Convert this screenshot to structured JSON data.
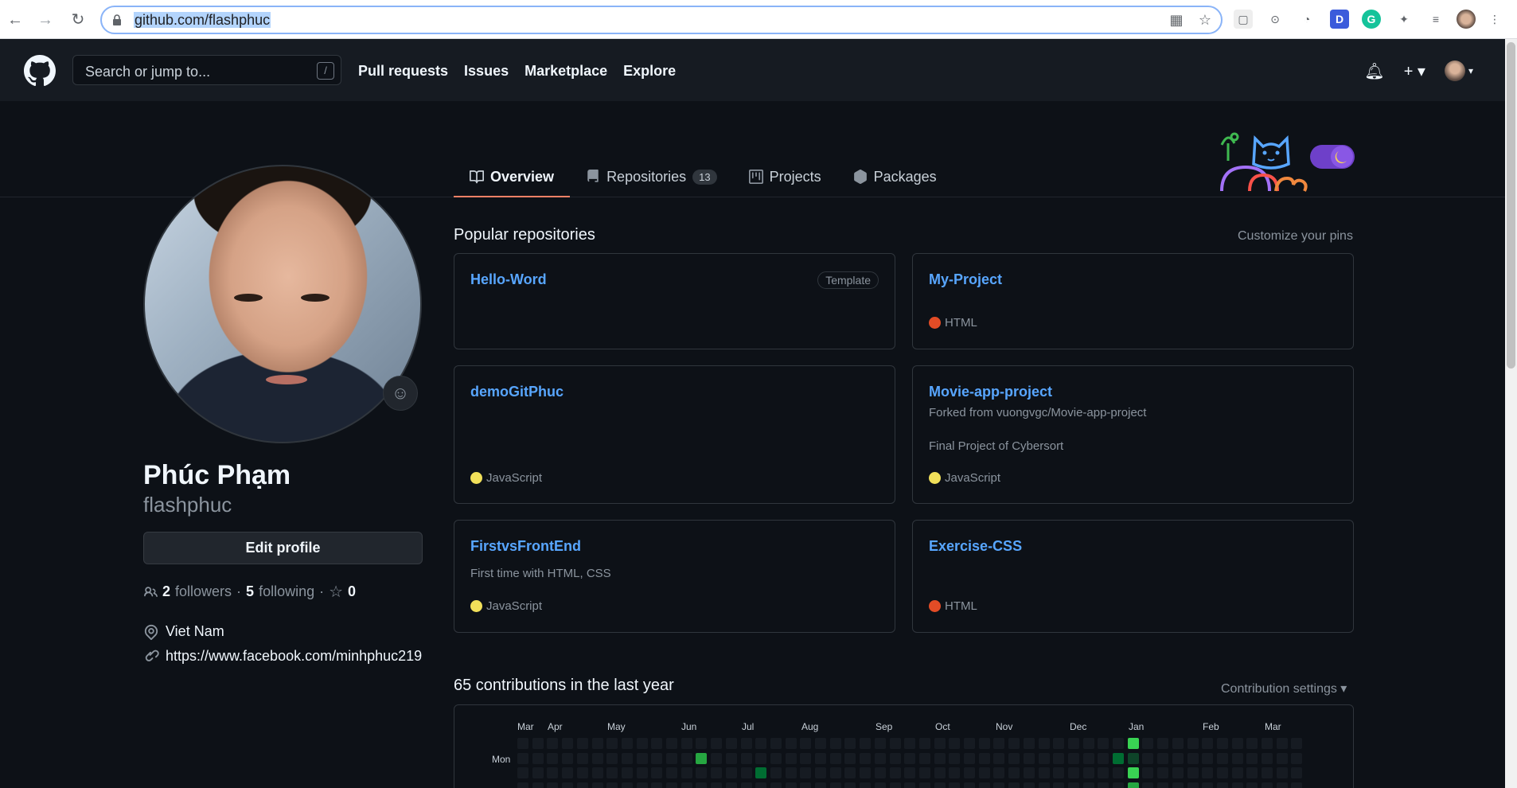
{
  "browser": {
    "url_prefix": "github.com/flashphuc",
    "back_icon": "arrow-left-icon",
    "forward_icon": "arrow-right-icon",
    "reload_icon": "reload-icon"
  },
  "header": {
    "search_placeholder": "Search or jump to...",
    "search_shortcut": "/",
    "nav": [
      "Pull requests",
      "Issues",
      "Marketplace",
      "Explore"
    ]
  },
  "tabs": [
    {
      "label": "Overview",
      "active": true
    },
    {
      "label": "Repositories",
      "count": "13"
    },
    {
      "label": "Projects"
    },
    {
      "label": "Packages"
    }
  ],
  "profile": {
    "fullname": "Phúc Phạm",
    "username": "flashphuc",
    "edit_label": "Edit profile",
    "followers_count": "2",
    "followers_label": "followers",
    "following_count": "5",
    "following_label": "following",
    "stars_count": "0",
    "location": "Viet Nam",
    "website": "https://www.facebook.com/minhphuc219"
  },
  "popular": {
    "title": "Popular repositories",
    "customize": "Customize your pins",
    "repos": [
      {
        "name": "Hello-Word",
        "badge": "Template"
      },
      {
        "name": "My-Project",
        "language": "HTML",
        "lang_color": "#e34c26"
      },
      {
        "name": "demoGitPhuc",
        "language": "JavaScript",
        "lang_color": "#f1e05a"
      },
      {
        "name": "Movie-app-project",
        "forked": "Forked from vuongvgc/Movie-app-project",
        "description": "Final Project of Cybersort",
        "language": "JavaScript",
        "lang_color": "#f1e05a"
      },
      {
        "name": "FirstvsFrontEnd",
        "description": "First time with HTML, CSS",
        "language": "JavaScript",
        "lang_color": "#f1e05a"
      },
      {
        "name": "Exercise-CSS",
        "language": "HTML",
        "lang_color": "#e34c26"
      }
    ]
  },
  "contributions": {
    "title": "65 contributions in the last year",
    "settings": "Contribution settings ▾",
    "months": [
      "Mar",
      "Apr",
      "May",
      "Jun",
      "Jul",
      "Aug",
      "Sep",
      "Oct",
      "Nov",
      "Dec",
      "Jan",
      "Feb",
      "Mar"
    ],
    "day_label": "Mon"
  },
  "colors": {
    "accent_tab": "#f78166",
    "link": "#58a6ff",
    "bg": "#0d1117",
    "contrib_level1": "#0e4429",
    "contrib_level2": "#006d32",
    "contrib_level3": "#26a641",
    "contrib_level4": "#39d353"
  }
}
